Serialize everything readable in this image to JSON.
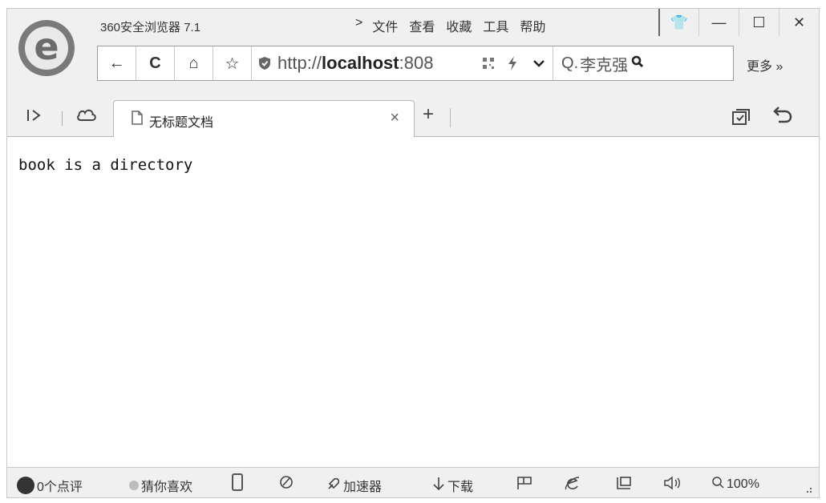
{
  "window": {
    "app_title": "360安全浏览器 7.1",
    "menu": [
      "文件",
      "查看",
      "收藏",
      "工具",
      "帮助"
    ],
    "menu_arrow": ">",
    "controls": {
      "skin": "👕",
      "minimize": "—",
      "maximize": "☐",
      "close": "✕"
    }
  },
  "navbar": {
    "back": "←",
    "refresh": "C",
    "home": "⌂",
    "favorite": "☆",
    "url_prefix": "http://",
    "url_host": "localhost",
    "url_suffix": ":808",
    "search_prefix": "Q.",
    "search_text": "李克强",
    "more": "更多 »"
  },
  "tabs": {
    "active_title": "无标题文档",
    "close": "×",
    "new_tab": "+"
  },
  "page": {
    "text": "book is a directory"
  },
  "statusbar": {
    "comments": "0个点评",
    "guess": "猜你喜欢",
    "accelerator": "加速器",
    "download": "下载",
    "zoom": "100%"
  },
  "icons": [
    "browser-logo-icon",
    "back-icon",
    "refresh-icon",
    "home-icon",
    "star-icon",
    "shield-icon",
    "qr-icon",
    "bolt-icon",
    "dropdown-icon",
    "search-icon",
    "sidebar-icon",
    "cloud-icon",
    "document-icon",
    "recent-tabs-icon",
    "undo-icon"
  ]
}
